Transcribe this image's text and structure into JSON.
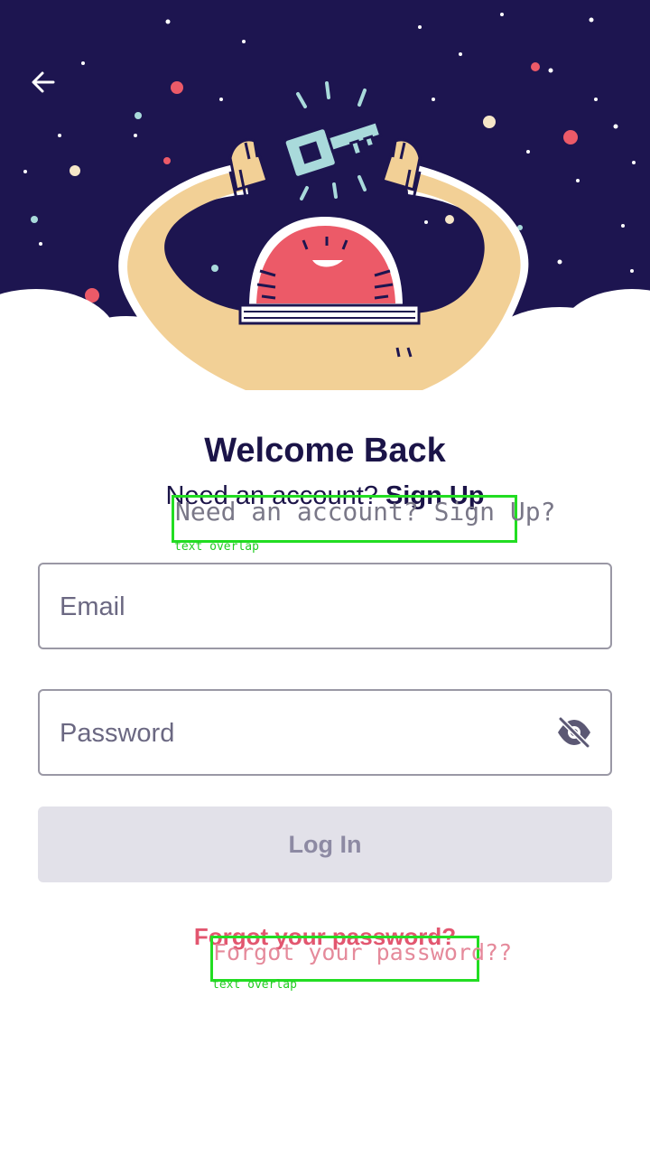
{
  "header": {
    "back_icon": "arrow-left-icon"
  },
  "hero": {
    "illustration": "astronaut-key-illustration",
    "colors": {
      "sky": "#1d1550",
      "skin": "#f2d096",
      "helmet": "#ec5a68",
      "key": "#a9dadb",
      "cloud": "#ffffff"
    }
  },
  "login": {
    "title": "Welcome Back",
    "subtitle_prefix": "Need an account? ",
    "signup_link": "Sign Up",
    "email_placeholder": "Email",
    "password_placeholder": "Password",
    "password_toggle_icon": "eye-off-icon",
    "login_button": "Log In",
    "forgot_link": "Forgot your password?"
  },
  "overlays": [
    {
      "text": "Need an account? Sign Up?",
      "label": "text overlap"
    },
    {
      "text": "Forgot your password??",
      "label": "text overlap"
    }
  ],
  "colors": {
    "title": "#1b1448",
    "accent_link": "#e2566f",
    "button_disabled_bg": "#e2e1e9",
    "button_disabled_text": "#8d8aa3",
    "overlay_box": "#22dd22"
  }
}
